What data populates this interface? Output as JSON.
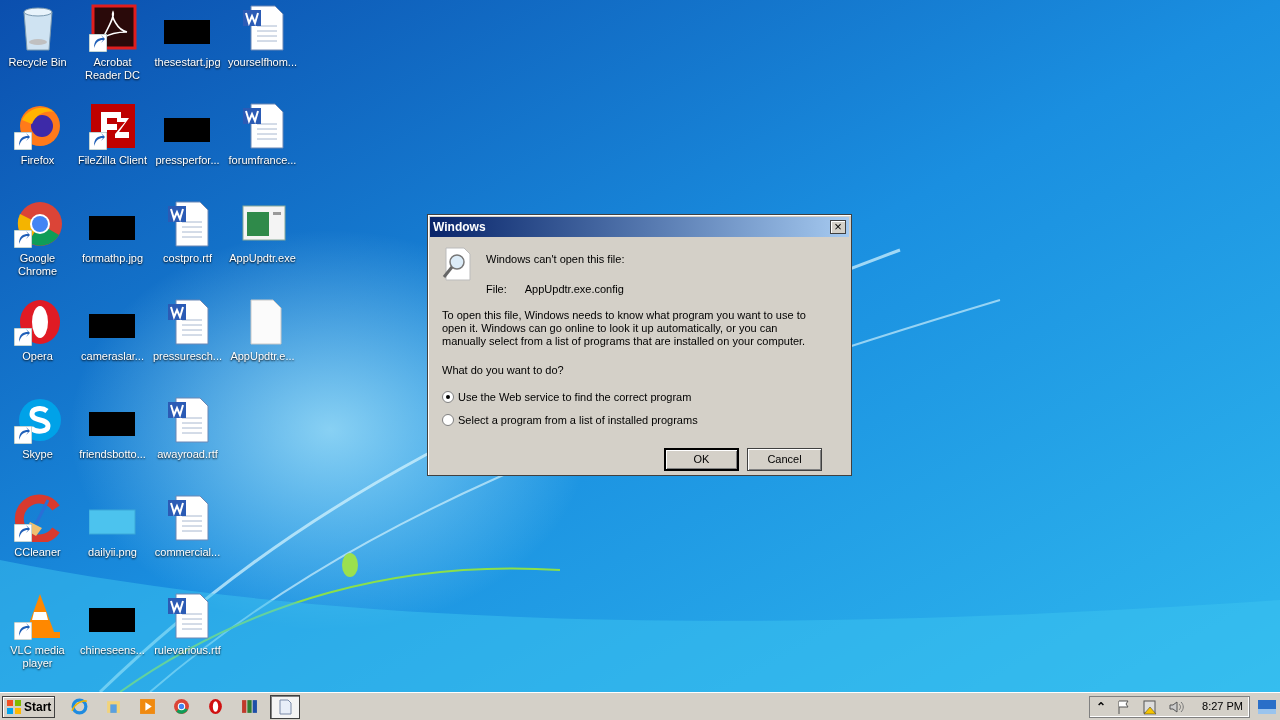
{
  "desktop": {
    "rows": [
      [
        {
          "kind": "recycle",
          "label": "Recycle Bin",
          "shortcut": false
        },
        {
          "kind": "acrobat",
          "label": "Acrobat Reader DC",
          "shortcut": true
        },
        {
          "kind": "dark-image",
          "label": "thesestart.jpg",
          "shortcut": false
        },
        {
          "kind": "word",
          "label": "yourselfhom...",
          "shortcut": false
        }
      ],
      [
        {
          "kind": "firefox",
          "label": "Firefox",
          "shortcut": true
        },
        {
          "kind": "filezilla",
          "label": "FileZilla Client",
          "shortcut": true
        },
        {
          "kind": "dark-image",
          "label": "pressperfor...",
          "shortcut": false
        },
        {
          "kind": "word",
          "label": "forumfrance...",
          "shortcut": false
        }
      ],
      [
        {
          "kind": "chrome",
          "label": "Google Chrome",
          "shortcut": true
        },
        {
          "kind": "dark-image",
          "label": "formathp.jpg",
          "shortcut": false
        },
        {
          "kind": "word",
          "label": "costpro.rtf",
          "shortcut": false
        },
        {
          "kind": "exe",
          "label": "AppUpdtr.exe",
          "shortcut": false
        }
      ],
      [
        {
          "kind": "opera",
          "label": "Opera",
          "shortcut": true
        },
        {
          "kind": "dark-image",
          "label": "cameraslar...",
          "shortcut": false
        },
        {
          "kind": "word",
          "label": "pressuresch...",
          "shortcut": false
        },
        {
          "kind": "blank",
          "label": "AppUpdtr.e...",
          "shortcut": false
        }
      ],
      [
        {
          "kind": "skype",
          "label": "Skype",
          "shortcut": true
        },
        {
          "kind": "dark-image",
          "label": "friendsbotto...",
          "shortcut": false
        },
        {
          "kind": "word",
          "label": "awayroad.rtf",
          "shortcut": false
        }
      ],
      [
        {
          "kind": "ccleaner",
          "label": "CCleaner",
          "shortcut": true
        },
        {
          "kind": "light-image",
          "label": "dailyii.png",
          "shortcut": false
        },
        {
          "kind": "word",
          "label": "commercial...",
          "shortcut": false
        }
      ],
      [
        {
          "kind": "vlc",
          "label": "VLC media player",
          "shortcut": true
        },
        {
          "kind": "dark-image",
          "label": "chineseens...",
          "shortcut": false
        },
        {
          "kind": "word",
          "label": "rulevarious.rtf",
          "shortcut": false
        }
      ]
    ]
  },
  "dialog": {
    "title": "Windows",
    "close": "×",
    "heading": "Windows can't open this file:",
    "file_label": "File:",
    "file_name": "AppUpdtr.exe.config",
    "message": "To open this file, Windows needs to know what program you want to use to open it. Windows can go online to look it up automatically, or you can manually select from a list of programs that are installed on your computer.",
    "question": "What do you want to do?",
    "options": [
      {
        "label": "Use the Web service to find the correct program",
        "selected": true
      },
      {
        "label": "Select a program from a list of installed programs",
        "selected": false
      }
    ],
    "buttons": [
      {
        "label": "OK",
        "default": true
      },
      {
        "label": "Cancel",
        "default": false
      }
    ]
  },
  "taskbar": {
    "start": "Start",
    "quick_launch": [
      {
        "kind": "ie"
      },
      {
        "kind": "folder"
      },
      {
        "kind": "media"
      },
      {
        "kind": "chrome"
      },
      {
        "kind": "opera"
      },
      {
        "kind": "winrar"
      }
    ],
    "windows": [
      {
        "kind": "file",
        "selected": true
      }
    ],
    "tray": {
      "chevron": "⌃",
      "time": "8:27 PM"
    }
  }
}
